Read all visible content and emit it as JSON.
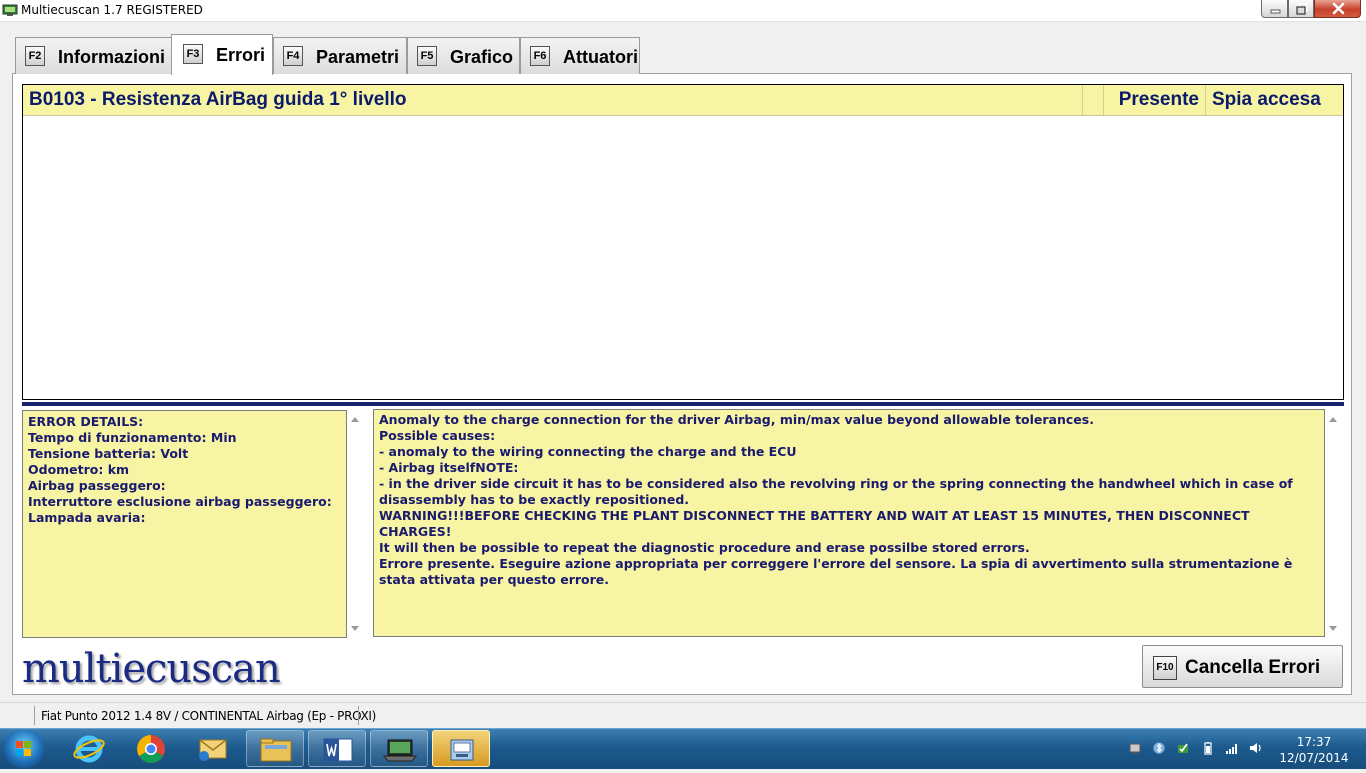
{
  "window": {
    "title": "Multiecuscan 1.7 REGISTERED"
  },
  "tabs": [
    {
      "key": "F2",
      "label": "Informazioni",
      "active": false
    },
    {
      "key": "F3",
      "label": "Errori",
      "active": true
    },
    {
      "key": "F4",
      "label": "Parametri",
      "active": false
    },
    {
      "key": "F5",
      "label": "Grafico",
      "active": false
    },
    {
      "key": "F6",
      "label": "Attuatori",
      "active": false
    }
  ],
  "errors_table": {
    "rows": [
      {
        "description": "B0103 - Resistenza AirBag guida 1° livello",
        "status": "Presente",
        "lamp": "Spia accesa"
      }
    ]
  },
  "error_details": {
    "lines": [
      "ERROR DETAILS:",
      "Tempo di funzionamento:  Min",
      "Tensione batteria:  Volt",
      "Odometro:  km",
      "Airbag passeggero:",
      "Interruttore esclusione airbag passeggero:",
      "Lampada avaria:"
    ]
  },
  "error_description": {
    "lines": [
      "Anomaly to the charge connection for the driver Airbag, min/max value beyond allowable tolerances.",
      "Possible causes:",
      "- anomaly to the wiring connecting the charge and the ECU",
      "- Airbag itselfNOTE:",
      "- in the driver side circuit it has to be considered also the revolving ring or the spring connecting the handwheel which in case of disassembly has to be exactly repositioned.",
      "WARNING!!!BEFORE CHECKING THE PLANT DISCONNECT THE BATTERY AND WAIT AT LEAST 15 MINUTES, THEN DISCONNECT CHARGES!",
      "It will then be possible to repeat the diagnostic procedure and erase possilbe stored errors.",
      "Errore presente. Eseguire azione appropriata per correggere l'errore del sensore. La spia di avvertimento sulla strumentazione è stata attivata per questo errore."
    ]
  },
  "logo": {
    "text": "multiecuscan"
  },
  "cancel_button": {
    "key": "F10",
    "label": "Cancella Errori"
  },
  "statusbar": {
    "vehicle": "Fiat Punto 2012 1.4 8V / CONTINENTAL Airbag (Ep - PROXI)"
  },
  "taskbar": {
    "pinned": [
      "internet-explorer",
      "chrome",
      "outlook",
      "file-explorer",
      "word",
      "laptop-app",
      "multiecuscan"
    ],
    "clock_time": "17:37",
    "clock_date": "12/07/2014"
  },
  "colors": {
    "panel_yellow": "#f7f4a3",
    "text_navy": "#0b1a6b",
    "divider_navy": "#16246e"
  }
}
